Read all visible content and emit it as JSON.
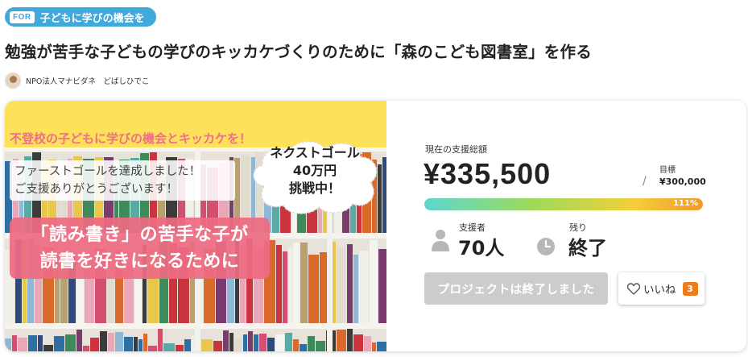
{
  "tag": {
    "prefix": "FOR",
    "label": "子どもに学びの機会を"
  },
  "project": {
    "title": "勉強が苦手な子どもの学びのキッカケづくりのために「森のこども図書室」を作る",
    "owner": "NPO法人マナビダネ　どばしひでこ"
  },
  "hero": {
    "headline": "不登校の子どもに学びの機会とキッカケを！",
    "first_goal_line1": "ファーストゴールを達成しました！",
    "first_goal_line2": "ご支援ありがとうございます！",
    "next_goal_line1": "ネクストゴール",
    "next_goal_line2": "40万円",
    "next_goal_line3": "挑戦中！",
    "message_line1": "「読み書き」の苦手な子が",
    "message_line2": "読書を好きになるために"
  },
  "funding": {
    "raised_label": "現在の支援総額",
    "raised_amount": "¥335,500",
    "goal_label": "目標",
    "goal_amount": "¥300,000",
    "progress_label": "111%",
    "progress_fraction": 1.11
  },
  "stats": {
    "supporters_label": "支援者",
    "supporters_value": "70人",
    "remaining_label": "残り",
    "remaining_value": "終了"
  },
  "actions": {
    "ended_label": "プロジェクトは終了しました",
    "like_label": "いいね",
    "like_count": "3"
  },
  "colors": {
    "tag_blue": "#3fa9dc",
    "hero_yellow": "#fde15a",
    "hero_pink": "#ee6e8c",
    "badge_orange": "#ee7c1a",
    "disabled_gray": "#cccccc"
  }
}
